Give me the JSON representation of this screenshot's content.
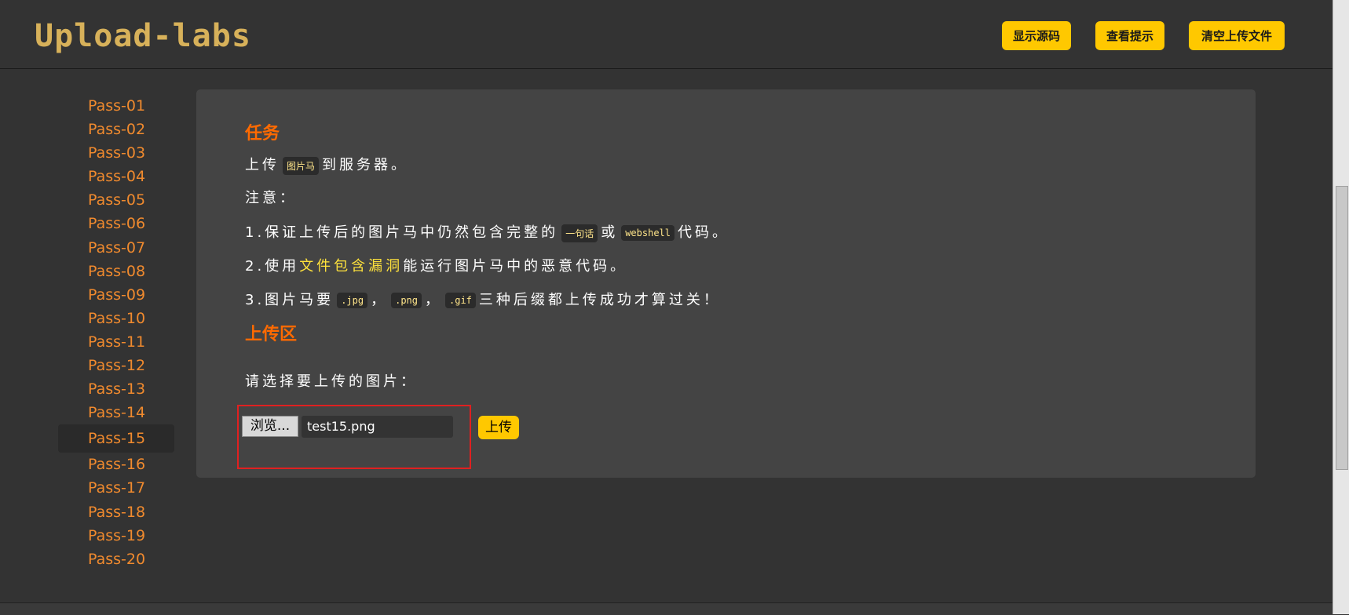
{
  "header": {
    "logo_text": "Upload-labs",
    "buttons": [
      "显示源码",
      "查看提示",
      "清空上传文件"
    ]
  },
  "sidebar": {
    "items": [
      "Pass-01",
      "Pass-02",
      "Pass-03",
      "Pass-04",
      "Pass-05",
      "Pass-06",
      "Pass-07",
      "Pass-08",
      "Pass-09",
      "Pass-10",
      "Pass-11",
      "Pass-12",
      "Pass-13",
      "Pass-14",
      "Pass-15",
      "Pass-16",
      "Pass-17",
      "Pass-18",
      "Pass-19",
      "Pass-20"
    ],
    "active": "Pass-15"
  },
  "task": {
    "title": "任务",
    "line1_pre": "上传",
    "line1_code": "图片马",
    "line1_post": "到服务器。",
    "note_label": "注意：",
    "r1_pre": "1.保证上传后的图片马中仍然包含完整的",
    "r1_code1": "一句话",
    "r1_mid": "或",
    "r1_code2": "webshell",
    "r1_post": "代码。",
    "r2_pre": "2.使用",
    "r2_highlight": "文件包含漏洞",
    "r2_post": "能运行图片马中的恶意代码。",
    "r3_pre": "3.图片马要",
    "r3_code1": ".jpg",
    "r3_sep1": "，",
    "r3_code2": ".png",
    "r3_sep2": "，",
    "r3_code3": ".gif",
    "r3_post": "三种后缀都上传成功才算过关！"
  },
  "upload": {
    "title": "上传区",
    "prompt": "请选择要上传的图片：",
    "browse_label": "浏览...",
    "file_value": "test15.png",
    "submit_label": "上传"
  },
  "colors": {
    "accent": "#ffc800",
    "sidebar_link": "#f08a2e",
    "section_title": "#ff6a00",
    "highlight_box": "#e02020"
  }
}
